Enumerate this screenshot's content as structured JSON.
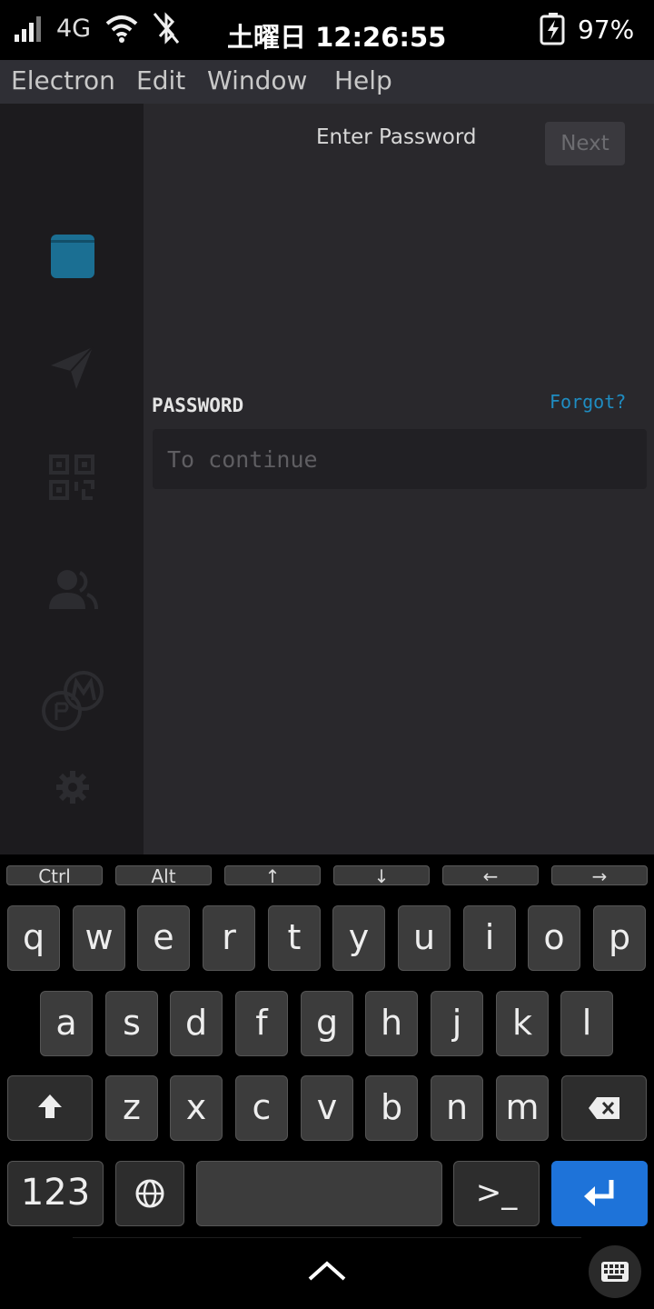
{
  "status_bar": {
    "network": "4G",
    "time": "土曜日 12:26:55",
    "battery": "97%"
  },
  "menu": [
    "Electron",
    "Edit",
    "Window",
    "Help"
  ],
  "sidebar": {
    "items": [
      {
        "icon": "wallet-icon",
        "active": true
      },
      {
        "icon": "send-icon",
        "active": false
      },
      {
        "icon": "qr-code-icon",
        "active": false
      },
      {
        "icon": "contacts-icon",
        "active": false
      },
      {
        "icon": "coins-icon",
        "active": false
      },
      {
        "icon": "gear-icon",
        "active": false
      }
    ]
  },
  "main": {
    "title": "Enter Password",
    "next_label": "Next",
    "password_label": "PASSWORD",
    "forgot_label": "Forgot?",
    "password_placeholder": "To continue"
  },
  "keyboard": {
    "special_keys": [
      "Ctrl",
      "Alt",
      "↑",
      "↓",
      "←",
      "→"
    ],
    "row1": [
      "q",
      "w",
      "e",
      "r",
      "t",
      "y",
      "u",
      "i",
      "o",
      "p"
    ],
    "row2": [
      "a",
      "s",
      "d",
      "f",
      "g",
      "h",
      "j",
      "k",
      "l"
    ],
    "row3": [
      "z",
      "x",
      "c",
      "v",
      "b",
      "n",
      "m"
    ],
    "numbers_label": "123",
    "terminal_label": ">_"
  },
  "colors": {
    "accent": "#1f8dc2",
    "enter_key": "#1e73d9",
    "active_icon": "#1b6f93"
  }
}
